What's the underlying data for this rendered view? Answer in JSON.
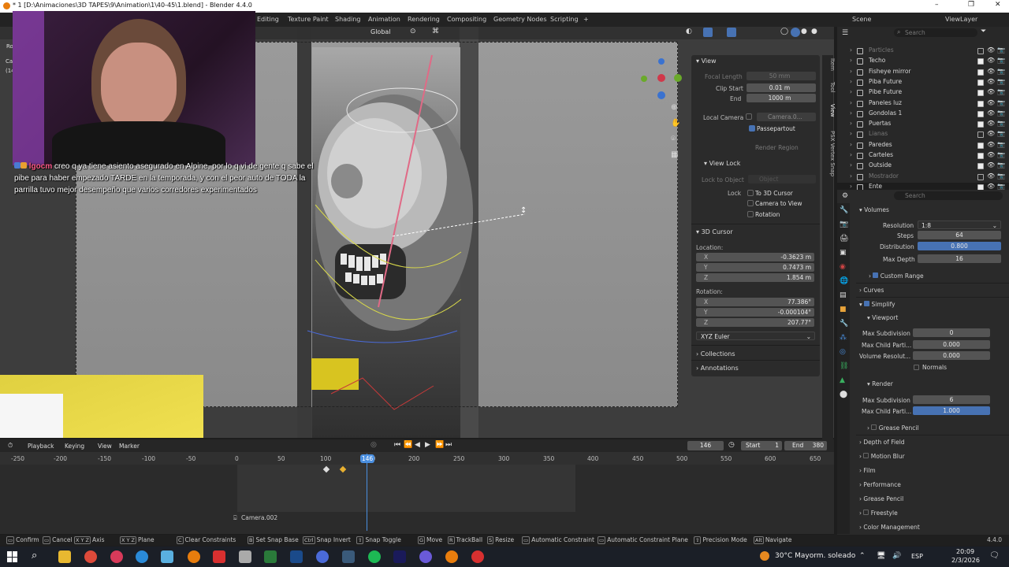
{
  "titlebar": {
    "title": "* 1 [D:\\Animaciones\\3D TAPES\\9\\Animation\\1\\40-45\\1.blend] - Blender 4.4.0",
    "minimize": "–",
    "maximize": "❐",
    "close": "✕"
  },
  "menubar": {
    "workspaces": [
      "Editing",
      "Texture Paint",
      "Shading",
      "Animation",
      "Rendering",
      "Compositing",
      "Geometry Nodes",
      "Scripting"
    ],
    "add_workspace": "+",
    "scene_label": "Scene",
    "viewlayer_label": "ViewLayer"
  },
  "viewport": {
    "orientation": "Global",
    "left_clip_1": "Ca",
    "left_clip_2": "(14",
    "left_clip_3": "Ro"
  },
  "chat": {
    "username": "lgocm",
    "message": "creo q ya tiene asiento asegurado en Alpine, por lo q vi de gente q sabe el pibe para haber empezado TARDE en la temporada, y con el peor auto de TODA la parrilla tuvo mejor desempeño que varios corredores experimentados"
  },
  "npanel": {
    "view_header": "View",
    "focal_length_label": "Focal Length",
    "focal_length": "50 mm",
    "clip_start_label": "Clip Start",
    "clip_start": "0.01 m",
    "end_label": "End",
    "end": "1000 m",
    "local_camera_label": "Local Camera",
    "local_camera": "Camera.0...",
    "passepartout": "Passepartout",
    "render_region": "Render Region",
    "view_lock_header": "View Lock",
    "lock_to_object_label": "Lock to Object",
    "lock_object_placeholder": "Object",
    "lock_label": "Lock",
    "to_3d_cursor": "To 3D Cursor",
    "camera_to_view": "Camera to View",
    "rotation_lock": "Rotation",
    "cursor_header": "3D Cursor",
    "location_label": "Location:",
    "loc_x": "-0.3623 m",
    "loc_y": "0.7473 m",
    "loc_z": "1.854 m",
    "rotation_label": "Rotation:",
    "rot_x": "77.386°",
    "rot_y": "-0.000104°",
    "rot_z": "207.77°",
    "euler": "XYZ Euler",
    "collections": "Collections",
    "annotations": "Annotations",
    "axis_x": "X",
    "axis_y": "Y",
    "axis_z": "Z"
  },
  "ntabs": [
    "Item",
    "Tool",
    "View",
    "PSX Vertex Snap"
  ],
  "outliner": {
    "search_placeholder": "Search",
    "rows": [
      {
        "name": "Particles",
        "dim": true
      },
      {
        "name": "Techo",
        "dim": false
      },
      {
        "name": "Fisheye mirror",
        "dim": false
      },
      {
        "name": "Piba Future",
        "dim": false
      },
      {
        "name": "Pibe Future",
        "dim": false
      },
      {
        "name": "Paneles luz",
        "dim": false
      },
      {
        "name": "Gondolas 1",
        "dim": false
      },
      {
        "name": "Puertas",
        "dim": false
      },
      {
        "name": "Lianas",
        "dim": true
      },
      {
        "name": "Paredes",
        "dim": false
      },
      {
        "name": "Carteles",
        "dim": false
      },
      {
        "name": "Outside",
        "dim": false
      },
      {
        "name": "Mostrador",
        "dim": true
      },
      {
        "name": "Ente",
        "dim": false
      }
    ]
  },
  "properties": {
    "search_placeholder": "Search",
    "volumes": "Volumes",
    "resolution_label": "Resolution",
    "resolution": "1:8",
    "steps_label": "Steps",
    "steps": "64",
    "distribution_label": "Distribution",
    "distribution": "0.800",
    "max_depth_label": "Max Depth",
    "max_depth": "16",
    "custom_range": "Custom Range",
    "curves": "Curves",
    "simplify": "Simplify",
    "viewport": "Viewport",
    "max_subdivision_label": "Max Subdivision",
    "max_subdivision": "0",
    "max_child_label": "Max Child Parti...",
    "max_child": "0.000",
    "volume_res_label": "Volume Resolut...",
    "volume_res": "0.000",
    "normals": "Normals",
    "render": "Render",
    "r_max_subdivision": "6",
    "r_max_child": "1.000",
    "grease_pencil_sub": "Grease Pencil",
    "depth_of_field": "Depth of Field",
    "motion_blur": "Motion Blur",
    "film": "Film",
    "performance": "Performance",
    "grease_pencil": "Grease Pencil",
    "freestyle": "Freestyle",
    "color_management": "Color Management"
  },
  "timeline": {
    "playback": "Playback",
    "keying": "Keying",
    "view": "View",
    "marker": "Marker",
    "current_frame": "146",
    "start_label": "Start",
    "start": "1",
    "end_label": "End",
    "end": "380",
    "ruler": [
      "-250",
      "-200",
      "-150",
      "-100",
      "-50",
      "0",
      "50",
      "100",
      "150",
      "200",
      "250",
      "300",
      "350",
      "400",
      "450",
      "500",
      "550",
      "600",
      "650"
    ],
    "playhead": "146",
    "camera_marker": "Camera.002"
  },
  "statusbar": {
    "items": [
      {
        "key": "",
        "label": "Confirm"
      },
      {
        "key": "",
        "label": "Cancel"
      },
      {
        "key": "X Y Z",
        "label": "Axis"
      },
      {
        "key": "X Y Z",
        "label": "Plane"
      },
      {
        "key": "C",
        "label": "Clear Constraints"
      },
      {
        "key": "B",
        "label": "Set Snap Base"
      },
      {
        "key": "Ctrl",
        "label": "Snap Invert"
      },
      {
        "key": "⇧",
        "label": "Snap Toggle"
      },
      {
        "key": "G",
        "label": "Move"
      },
      {
        "key": "R",
        "label": "TrackBall"
      },
      {
        "key": "S",
        "label": "Resize"
      },
      {
        "key": "",
        "label": "Automatic Constraint"
      },
      {
        "key": "",
        "label": "Automatic Constraint Plane"
      },
      {
        "key": "⇧",
        "label": "Precision Mode"
      },
      {
        "key": "Alt",
        "label": "Navigate"
      }
    ],
    "version": "4.4.0"
  },
  "taskbar": {
    "weather": "30°C  Mayorm. soleado",
    "lang": "ESP",
    "time": "20:09",
    "date": "2/3/2026"
  },
  "colors": {
    "accent": "#4772b3",
    "playhead": "#4a8fe0"
  }
}
